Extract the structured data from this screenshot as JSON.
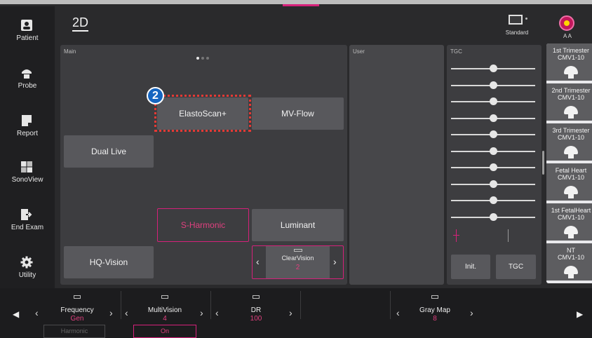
{
  "header": {
    "mode_title": "2D",
    "preset_label": "Standard",
    "user_initials": "A A"
  },
  "sidebar": {
    "items": [
      {
        "label": "Patient",
        "icon": "patient-icon"
      },
      {
        "label": "Probe",
        "icon": "probe-icon"
      },
      {
        "label": "Report",
        "icon": "report-icon"
      },
      {
        "label": "SonoView",
        "icon": "sonoview-icon"
      },
      {
        "label": "End Exam",
        "icon": "end-exam-icon"
      },
      {
        "label": "Utility",
        "icon": "gear-icon"
      }
    ]
  },
  "main_panel": {
    "title": "Main",
    "buttons": {
      "elastoscan": "ElastoScan+",
      "mvflow": "MV-Flow",
      "dual_live": "Dual Live",
      "sharmonic": "S-Harmonic",
      "luminant": "Luminant",
      "hqvision": "HQ-Vision"
    },
    "clearvision": {
      "label": "ClearVision",
      "value": "2"
    },
    "step_badge": "2"
  },
  "user_panel": {
    "title": "User"
  },
  "tgc_panel": {
    "title": "TGC",
    "init_label": "Init.",
    "tgc_label": "TGC",
    "slider_count": 10
  },
  "presets": [
    {
      "name": "1st Trimester",
      "probe": "CMV1-10"
    },
    {
      "name": "2nd Trimester",
      "probe": "CMV1-10"
    },
    {
      "name": "3rd Trimester",
      "probe": "CMV1-10"
    },
    {
      "name": "Fetal Heart",
      "probe": "CMV1-10"
    },
    {
      "name": "1st FetalHeart",
      "probe": "CMV1-10"
    },
    {
      "name": "NT",
      "probe": "CMV1-10"
    }
  ],
  "bottom": {
    "frequency": {
      "label": "Frequency",
      "value": "Gen",
      "sub": "Harmonic"
    },
    "multivision": {
      "label": "MultiVision",
      "value": "4",
      "sub": "On"
    },
    "dr": {
      "label": "DR",
      "value": "100"
    },
    "graymap": {
      "label": "Gray Map",
      "value": "8"
    }
  },
  "colors": {
    "accent": "#d6217a",
    "highlight_box": "#e53935",
    "badge": "#1565c0"
  }
}
